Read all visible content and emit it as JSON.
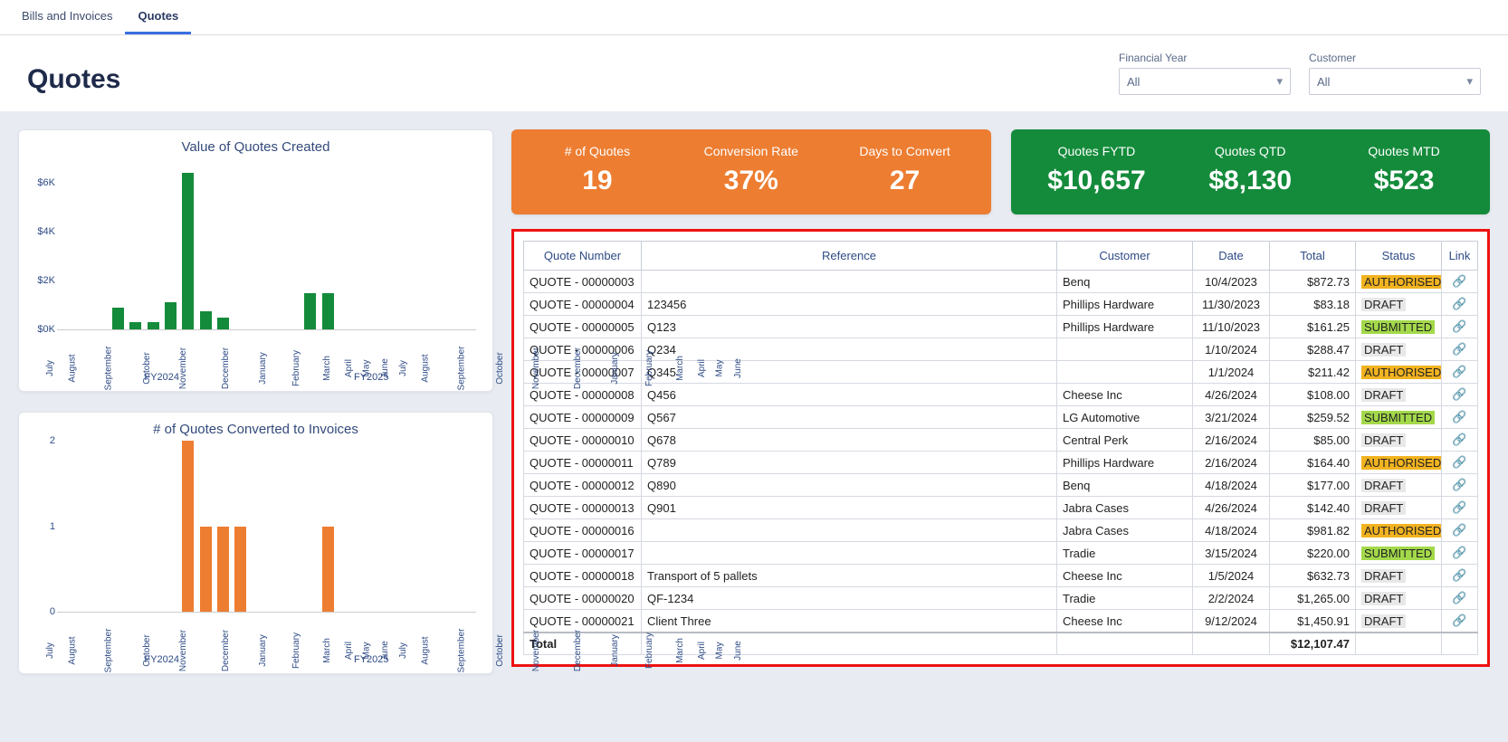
{
  "tabs": {
    "bills": "Bills and Invoices",
    "quotes": "Quotes"
  },
  "page_title": "Quotes",
  "filters": {
    "fy": {
      "label": "Financial Year",
      "value": "All"
    },
    "customer": {
      "label": "Customer",
      "value": "All"
    }
  },
  "kpis": {
    "orange": [
      {
        "label": "# of Quotes",
        "value": "19"
      },
      {
        "label": "Conversion Rate",
        "value": "37%"
      },
      {
        "label": "Days to Convert",
        "value": "27"
      }
    ],
    "green": [
      {
        "label": "Quotes FYTD",
        "value": "$10,657"
      },
      {
        "label": "Quotes QTD",
        "value": "$8,130"
      },
      {
        "label": "Quotes MTD",
        "value": "$523"
      }
    ]
  },
  "table": {
    "headers": [
      "Quote Number",
      "Reference",
      "Customer",
      "Date",
      "Total",
      "Status",
      "Link"
    ],
    "rows": [
      {
        "num": "QUOTE - 00000003",
        "ref": "",
        "cust": "Benq",
        "date": "10/4/2023",
        "total": "$872.73",
        "status": "AUTHORISED"
      },
      {
        "num": "QUOTE - 00000004",
        "ref": "123456",
        "cust": "Phillips Hardware",
        "date": "11/30/2023",
        "total": "$83.18",
        "status": "DRAFT"
      },
      {
        "num": "QUOTE - 00000005",
        "ref": "Q123",
        "cust": "Phillips Hardware",
        "date": "11/10/2023",
        "total": "$161.25",
        "status": "SUBMITTED"
      },
      {
        "num": "QUOTE - 00000006",
        "ref": "Q234",
        "cust": "",
        "date": "1/10/2024",
        "total": "$288.47",
        "status": "DRAFT"
      },
      {
        "num": "QUOTE - 00000007",
        "ref": "Q345",
        "cust": "",
        "date": "1/1/2024",
        "total": "$211.42",
        "status": "AUTHORISED"
      },
      {
        "num": "QUOTE - 00000008",
        "ref": "Q456",
        "cust": "Cheese Inc",
        "date": "4/26/2024",
        "total": "$108.00",
        "status": "DRAFT"
      },
      {
        "num": "QUOTE - 00000009",
        "ref": "Q567",
        "cust": "LG Automotive",
        "date": "3/21/2024",
        "total": "$259.52",
        "status": "SUBMITTED"
      },
      {
        "num": "QUOTE - 00000010",
        "ref": "Q678",
        "cust": "Central Perk",
        "date": "2/16/2024",
        "total": "$85.00",
        "status": "DRAFT"
      },
      {
        "num": "QUOTE - 00000011",
        "ref": "Q789",
        "cust": "Phillips Hardware",
        "date": "2/16/2024",
        "total": "$164.40",
        "status": "AUTHORISED"
      },
      {
        "num": "QUOTE - 00000012",
        "ref": "Q890",
        "cust": "Benq",
        "date": "4/18/2024",
        "total": "$177.00",
        "status": "DRAFT"
      },
      {
        "num": "QUOTE - 00000013",
        "ref": "Q901",
        "cust": "Jabra Cases",
        "date": "4/26/2024",
        "total": "$142.40",
        "status": "DRAFT"
      },
      {
        "num": "QUOTE - 00000016",
        "ref": "",
        "cust": "Jabra Cases",
        "date": "4/18/2024",
        "total": "$981.82",
        "status": "AUTHORISED"
      },
      {
        "num": "QUOTE - 00000017",
        "ref": "",
        "cust": "Tradie",
        "date": "3/15/2024",
        "total": "$220.00",
        "status": "SUBMITTED"
      },
      {
        "num": "QUOTE - 00000018",
        "ref": "Transport of 5 pallets",
        "cust": "Cheese Inc",
        "date": "1/5/2024",
        "total": "$632.73",
        "status": "DRAFT"
      },
      {
        "num": "QUOTE - 00000020",
        "ref": "QF-1234",
        "cust": "Tradie",
        "date": "2/2/2024",
        "total": "$1,265.00",
        "status": "DRAFT"
      },
      {
        "num": "QUOTE - 00000021",
        "ref": "Client Three",
        "cust": "Cheese Inc",
        "date": "9/12/2024",
        "total": "$1,450.91",
        "status": "DRAFT"
      }
    ],
    "total_label": "Total",
    "total_value": "$12,107.47"
  },
  "chart_data": [
    {
      "id": "value_created",
      "type": "bar",
      "title": "Value of Quotes Created",
      "ylabel": "",
      "ylim": [
        0,
        7000
      ],
      "yticks": [
        "$0K",
        "$2K",
        "$4K",
        "$6K"
      ],
      "categories": [
        "July",
        "August",
        "September",
        "October",
        "November",
        "December",
        "January",
        "February",
        "March",
        "April",
        "May",
        "June",
        "July",
        "August",
        "September",
        "October",
        "November",
        "December",
        "January",
        "February",
        "March",
        "April",
        "May",
        "June"
      ],
      "fy_groups": [
        "FY2024",
        "FY2025"
      ],
      "values": [
        0,
        0,
        0,
        900,
        300,
        300,
        1100,
        6400,
        750,
        500,
        0,
        0,
        0,
        0,
        1500,
        1500,
        0,
        0,
        0,
        0,
        0,
        0,
        0,
        0
      ],
      "color": "green"
    },
    {
      "id": "quotes_converted",
      "type": "bar",
      "title": "# of Quotes Converted to Invoices",
      "ylabel": "",
      "ylim": [
        0,
        2
      ],
      "yticks": [
        "0",
        "1",
        "2"
      ],
      "categories": [
        "July",
        "August",
        "September",
        "October",
        "November",
        "December",
        "January",
        "February",
        "March",
        "April",
        "May",
        "June",
        "July",
        "August",
        "September",
        "October",
        "November",
        "December",
        "January",
        "February",
        "March",
        "April",
        "May",
        "June"
      ],
      "fy_groups": [
        "FY2024",
        "FY2025"
      ],
      "values": [
        0,
        0,
        0,
        0,
        0,
        0,
        0,
        2,
        1,
        1,
        1,
        0,
        0,
        0,
        0,
        1,
        0,
        0,
        0,
        0,
        0,
        0,
        0,
        0
      ],
      "color": "orange"
    }
  ]
}
